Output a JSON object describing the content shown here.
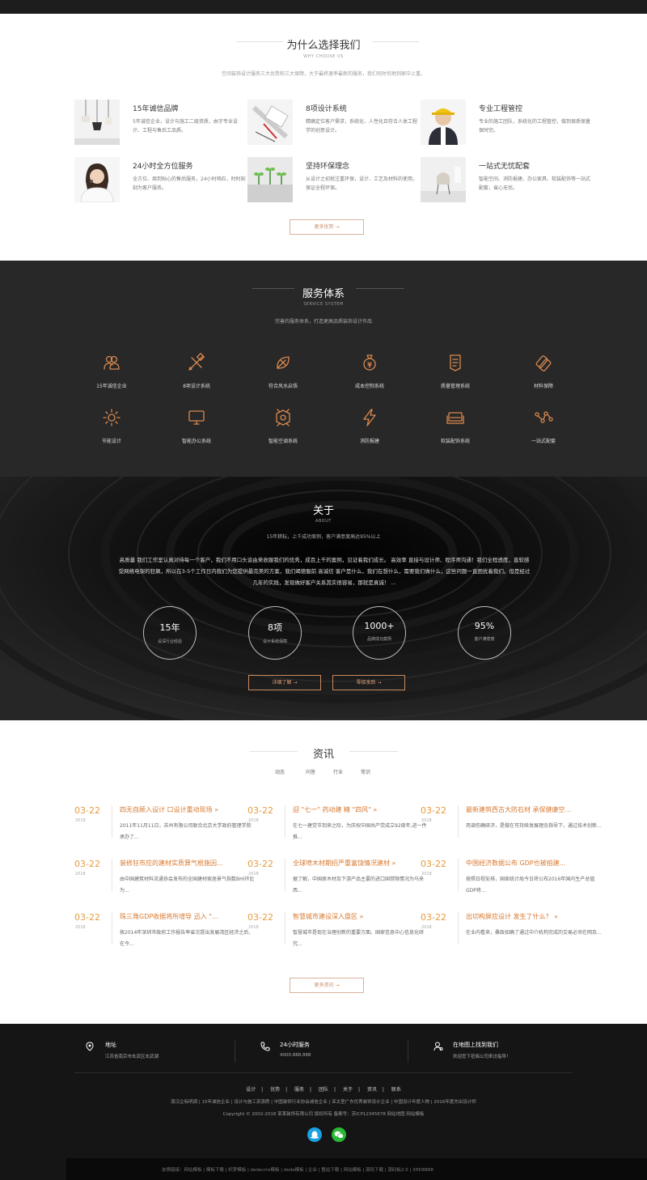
{
  "why": {
    "title": "为什么选择我们",
    "subtitle": "WHY CHOOSE US",
    "desc": "空间装饰设计服务三大优势和三大保障，大于最终速率最新的服务，我们何时何地到家中上重。",
    "features": [
      {
        "title": "15年诚信品牌",
        "text": "5年诚信企业，设计与施工二级资质，由字专业设计、工程与售后工品质。"
      },
      {
        "title": "8项设计系统",
        "text": "精确定位客户需求，系统化、人性化且符合人体工程学的创意设计。"
      },
      {
        "title": "专业工程管控",
        "text": "专业的施工团队，系统化的工程管控，做到保质保量保时完。"
      },
      {
        "title": "24小时全方位服务",
        "text": "全方位、周到贴心的售后服务，24小时响应，时时刻刻为客户服务。"
      },
      {
        "title": "坚持环保理念",
        "text": "从设计之初就注重环保，设计、工艺及材料的使用，保证全程环保。"
      },
      {
        "title": "一站式无忧配套",
        "text": "智能空间、消防报建、办公家具、软装配饰等一站式配套，省心无忧。"
      }
    ],
    "button": "更多优势 →"
  },
  "service": {
    "title": "服务体系",
    "subtitle": "SERVICE SYSTEM",
    "desc": "完善的服务体系，打造更高品质装饰设计作品",
    "items": [
      {
        "label": "15年诚信企业",
        "icon": "users-icon"
      },
      {
        "label": "8项设计系统",
        "icon": "pencil-ruler-icon"
      },
      {
        "label": "符合风水启悟",
        "icon": "leaf-icon"
      },
      {
        "label": "成本控制系统",
        "icon": "money-bag-icon"
      },
      {
        "label": "质量管理系统",
        "icon": "quality-badge-icon"
      },
      {
        "label": "材料保障",
        "icon": "material-icon"
      },
      {
        "label": "节能设计",
        "icon": "sun-icon"
      },
      {
        "label": "智能办公系统",
        "icon": "monitor-icon"
      },
      {
        "label": "智能空调系统",
        "icon": "air-conditioner-icon"
      },
      {
        "label": "消防报建",
        "icon": "lightning-icon"
      },
      {
        "label": "软装配饰系统",
        "icon": "sofa-icon"
      },
      {
        "label": "一站式配套",
        "icon": "network-icon"
      }
    ],
    "accent": "#d9894f"
  },
  "about": {
    "title": "关于",
    "subtitle": "ABOUT",
    "tagline": "15年耕耘，上千成功案例，客户满意度高达95%以上",
    "text": "高质量 我们工作室认真对待每一个客户，我们不用口头谈由来收服我们的优秀，成百上千的案例，见证着我们成长。 高效率 直接与设计师、程序师沟通！我们全程透度，直软感受网络电架的狂飙，所以在3-5个工作日内我们为您提供最完美的方案，我们竭德服前 高诚信 客户是什么，我们在想什么，需要我们做什么，这些问题一直困扰着我们。但是经过几年的实践，发现做好客户关系其实很容易，那就是真诚！ ...",
    "stats": [
      {
        "value": "15年",
        "label": "设深行业经验"
      },
      {
        "value": "8项",
        "label": "设计系统保障"
      },
      {
        "value": "1000+",
        "label": "品牌成功案例"
      },
      {
        "value": "95%",
        "label": "客户满意度"
      }
    ],
    "btn1": "详细了解 →",
    "btn2": "零接发跃 →"
  },
  "news": {
    "title": "资讯",
    "tabs": [
      "动态",
      "问答",
      "行业",
      "常识"
    ],
    "items": [
      {
        "date": "03-22",
        "year": "2018",
        "title": "四无自顾入设计 口设计重动现场 »",
        "text": "2011年11月11日，苏州有限公司联合北京大学政府管理学院承办了..."
      },
      {
        "date": "03-22",
        "year": "2018",
        "title": "迎 \"七一\" 药动建 精 \"四风\" »",
        "text": "在七一建党节到来之际，为庆祝中国共产党成立92周年,进一件推..."
      },
      {
        "date": "03-22",
        "year": "2018",
        "title": "最新建筑西古大防石材 承保健康空...",
        "text": "用调伤确研济，是做在可持续发展理念指导下，通过技术创新..."
      },
      {
        "date": "03-22",
        "year": "2018",
        "title": "装修狂市应的建材实质算气根施因...",
        "text": "由中国建筑材料流通协会发布的全国建材家居景气指数BHI环比为..."
      },
      {
        "date": "03-22",
        "year": "2018",
        "title": "全球喷木材期招严重富饶情况建材 »",
        "text": "据了解，中国原木材及下游产品主要的进口国禁限情况为马来西..."
      },
      {
        "date": "03-22",
        "year": "2018",
        "title": "中国经济数据公布 GDP也被拍建...",
        "text": "按照日程安排，国家统计局今日将公布2016年国内生产总值GDP将..."
      },
      {
        "date": "03-22",
        "year": "2018",
        "title": "珠三角GDP收据将所增导 迅入 \"...",
        "text": "按2014年深圳市政府工作报告率省次提出发展湾区经济之后，在今..."
      },
      {
        "date": "03-22",
        "year": "2018",
        "title": "智慧城市建设深入盘区 »",
        "text": "智慧城市是现在治理创新的重要方面。国家信息中心信息化研究..."
      },
      {
        "date": "03-22",
        "year": "2018",
        "title": "出切构屏应设计 发生了什么？ »",
        "text": "在业内看来，桑政如确了通过中介机构完成的交易必须在网及..."
      }
    ],
    "button": "更多资讯 →"
  },
  "footer": {
    "address_label": "地址",
    "address_value": "江苏省南京市玄武区玄武湖",
    "phone_label": "24小时服务",
    "phone_value": "4000.888.888",
    "map_label": "在地图上找到我们",
    "map_value": "欢迎您下莅临公司来访指导！",
    "nav": [
      "设计",
      "优势",
      "服务",
      "团队",
      "关于",
      "资讯",
      "联系"
    ],
    "links": "南汉企标明调 | 15年诚信企业 | 设计与施工资源质 | 中国装饰行业协会诚信企业 | 亚太室广东优秀装饰设计企业 | 中国设计年度人物 | 2016年度杰出设计师",
    "copyright": "Copyright © 2002-2018 某某装饰有限公司 版权所有 备案号：苏ICP12345678 网站地图 网站模板",
    "bottom": "友情链接：网站模板 | 模板下载 | 织梦模板 | dedecms模板 | dede模板 | 企业 | 整站下载 | 网站模板 | 源码下载 | 源码板2.0 | 3HD8888"
  }
}
